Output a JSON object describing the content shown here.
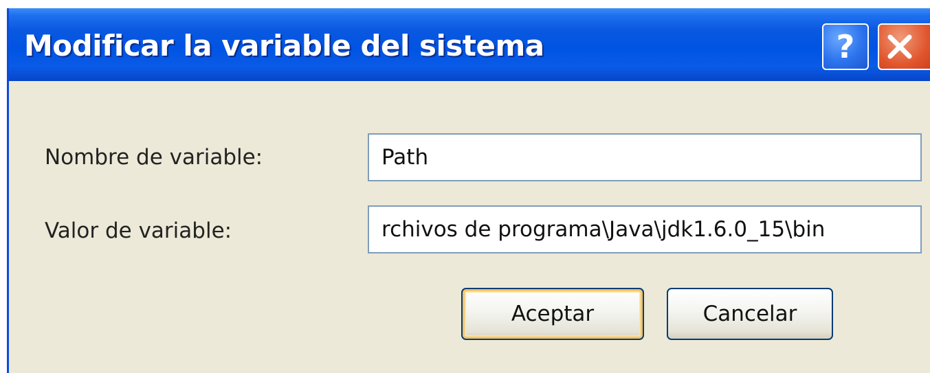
{
  "window": {
    "title": "Modificar la variable del sistema",
    "help_glyph": "?",
    "close_icon": "close-x-icon"
  },
  "form": {
    "name_label": "Nombre de variable:",
    "name_value": "Path",
    "value_label": "Valor de variable:",
    "value_value": "rchivos de programa\\Java\\jdk1.6.0_15\\bin"
  },
  "buttons": {
    "ok_label": "Aceptar",
    "cancel_label": "Cancelar"
  },
  "colors": {
    "titlebar": "#0054e3",
    "dialog_bg": "#ece9d8",
    "close_button": "#e0552c",
    "help_button": "#2d74ee",
    "default_button_highlight": "#f7c468"
  }
}
